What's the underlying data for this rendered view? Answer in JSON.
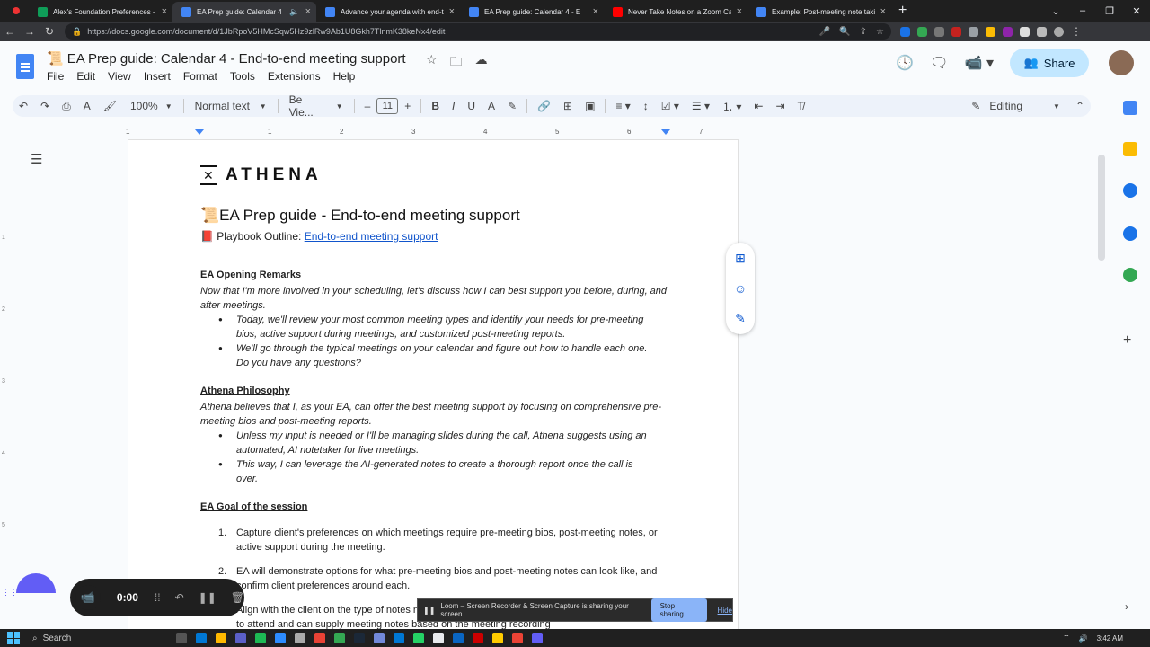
{
  "browser": {
    "tabs": [
      {
        "title": "Alex's Foundation Preferences - ",
        "color": "#0f9d58",
        "active": false
      },
      {
        "title": "EA Prep guide: Calendar 4",
        "color": "#4285f4",
        "active": true
      },
      {
        "title": "Advance your agenda with end-t",
        "color": "#4285f4",
        "active": false
      },
      {
        "title": "EA Prep guide: Calendar 4 - E",
        "color": "#4285f4",
        "active": false
      },
      {
        "title": "Never Take Notes on a Zoom Ca",
        "color": "#ff0000",
        "active": false
      },
      {
        "title": "Example: Post-meeting note taki",
        "color": "#4285f4",
        "active": false
      }
    ],
    "url": "https://docs.google.com/document/d/1JbRpoV5HMcSqw5Hz9zlRw9Ab1U8Gkh7TlnmK38keNx4/edit"
  },
  "doc": {
    "title": "EA Prep guide: Calendar 4 - End-to-end meeting support",
    "title_emoji": "📜",
    "menu": [
      "File",
      "Edit",
      "View",
      "Insert",
      "Format",
      "Tools",
      "Extensions",
      "Help"
    ],
    "share_label": "Share"
  },
  "toolbar": {
    "zoom": "100%",
    "style": "Normal text",
    "font": "Be Vie...",
    "font_size": "11",
    "mode": "Editing"
  },
  "ruler": [
    "1",
    "1",
    "2",
    "3",
    "4",
    "5",
    "6",
    "7"
  ],
  "vruler": [
    "1",
    "2",
    "3",
    "4",
    "5"
  ],
  "page": {
    "logo_text": "ATHENA",
    "heading": "EA Prep guide - End-to-end meeting support",
    "heading_emoji": "📜",
    "outline_emoji": "📕",
    "outline_label": "Playbook Outline: ",
    "outline_link": "End-to-end meeting support",
    "s1_title": "EA Opening Remarks",
    "s1_para": "Now that I'm more involved in your scheduling, let's discuss how I can best support you before, during, and after meetings.",
    "s1_b1": "Today, we'll review your most common meeting types and identify your needs for pre-meeting bios, active support during meetings, and customized post-meeting reports.",
    "s1_b2": "We'll go through the typical meetings on your calendar and figure out how to handle each one. Do you have any questions?",
    "s2_title": "Athena Philosophy",
    "s2_para": "Athena believes that I, as your EA, can offer the best meeting support by focusing on comprehensive pre-meeting bios and post-meeting reports.",
    "s2_b1": "Unless my input is needed or I'll be managing slides during the call, Athena suggests using an automated, AI notetaker for live meetings.",
    "s2_b2": "This way, I can leverage the AI-generated notes to create a thorough report once the call is over.",
    "s3_title": "EA Goal of the session",
    "n1_num": "1.",
    "n1": "Capture client's preferences on which meetings require pre-meeting bios, post-meeting notes, or active support during the meeting.",
    "n2_num": "2.",
    "n2": "EA will demonstrate options for what pre-meeting bios and post-meeting notes can look like, and confirm client preferences around each.",
    "n3_num": "3.",
    "n3": "Align with the client on the type of notes needed for each meeting, for example, EA not needed to attend and can supply meeting notes based on the meeting recording"
  },
  "loom": {
    "time": "0:00",
    "banner_text": "Loom – Screen Recorder & Screen Capture is sharing your screen.",
    "stop_label": "Stop sharing",
    "hide_label": "Hide"
  },
  "taskbar": {
    "search": "Search",
    "time": "3:42 AM"
  }
}
